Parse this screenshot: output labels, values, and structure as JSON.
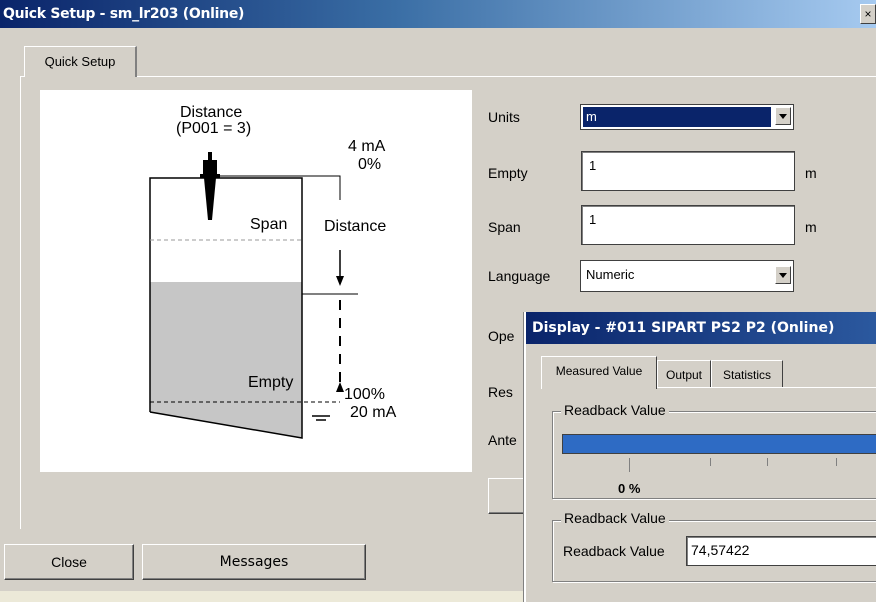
{
  "window": {
    "title": "Quick Setup - sm_lr203  (Online)",
    "close_glyph": "×"
  },
  "tabs": [
    {
      "label": "Quick Setup"
    }
  ],
  "diagram": {
    "distance_title": "Distance",
    "distance_param": "(P001 = 3)",
    "top_ma": "4 mA",
    "top_pct": "0%",
    "span_label": "Span",
    "distance_label": "Distance",
    "empty_label": "Empty",
    "bottom_pct": "100%",
    "bottom_ma": "20 mA"
  },
  "form": {
    "units_label": "Units",
    "units_value": "m",
    "empty_label": "Empty",
    "empty_value": "1",
    "empty_unit": "m",
    "span_label": "Span",
    "span_value": "1",
    "span_unit": "m",
    "language_label": "Language",
    "language_value": "Numeric",
    "ope_label_partial": "Ope",
    "res_label_partial": "Res",
    "ante_label_partial": "Ante"
  },
  "footer": {
    "close_label": "Close",
    "messages_label": "Messages"
  },
  "display_window": {
    "title": "Display - #011 SIPART PS2 P2  (Online)",
    "tabs": [
      {
        "label": "Measured Value"
      },
      {
        "label": "Output"
      },
      {
        "label": "Statistics"
      }
    ],
    "group1_label": "Readback Value",
    "bar_zero_label": "0 %",
    "group2_label": "Readback Value",
    "readback_label": "Readback Value",
    "readback_value": "74,57422"
  }
}
